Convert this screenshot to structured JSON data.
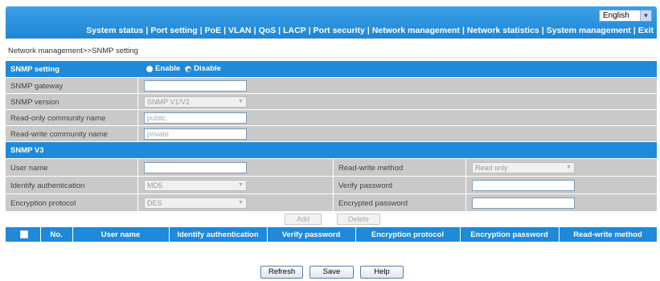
{
  "header": {
    "language": "English",
    "nav": [
      "System status",
      "Port setting",
      "PoE",
      "VLAN",
      "QoS",
      "LACP",
      "Port security",
      "Network management",
      "Network statistics",
      "System management",
      "Exit"
    ]
  },
  "breadcrumb": "Network management>>SNMP setting",
  "snmp": {
    "section_label": "SNMP setting",
    "enable_label": "Enable",
    "disable_label": "Disable",
    "selected": "Disable",
    "gateway_label": "SNMP gateway",
    "gateway_value": "",
    "version_label": "SNMP version",
    "version_value": "SNMP V1/V2",
    "ro_label": "Read-only community name",
    "ro_value": "public",
    "rw_label": "Read-write community name",
    "rw_value": "private"
  },
  "v3": {
    "section_label": "SNMP V3",
    "username_label": "User name",
    "username_value": "",
    "rw_method_label": "Read-write method",
    "rw_method_value": "Read only",
    "auth_label": "Identify authentication",
    "auth_value": "MD5",
    "verify_pw_label": "Verify password",
    "verify_pw_value": "",
    "enc_label": "Encryption protocol",
    "enc_value": "DES",
    "enc_pw_label": "Encrypted password",
    "enc_pw_value": "",
    "add_label": "Add",
    "delete_label": "Delete"
  },
  "table": {
    "columns": [
      "No.",
      "User name",
      "Identify authentication",
      "Verify password",
      "Encryption protocol",
      "Encryption password",
      "Read-write method"
    ]
  },
  "buttons": {
    "refresh": "Refresh",
    "save": "Save",
    "help": "Help"
  }
}
